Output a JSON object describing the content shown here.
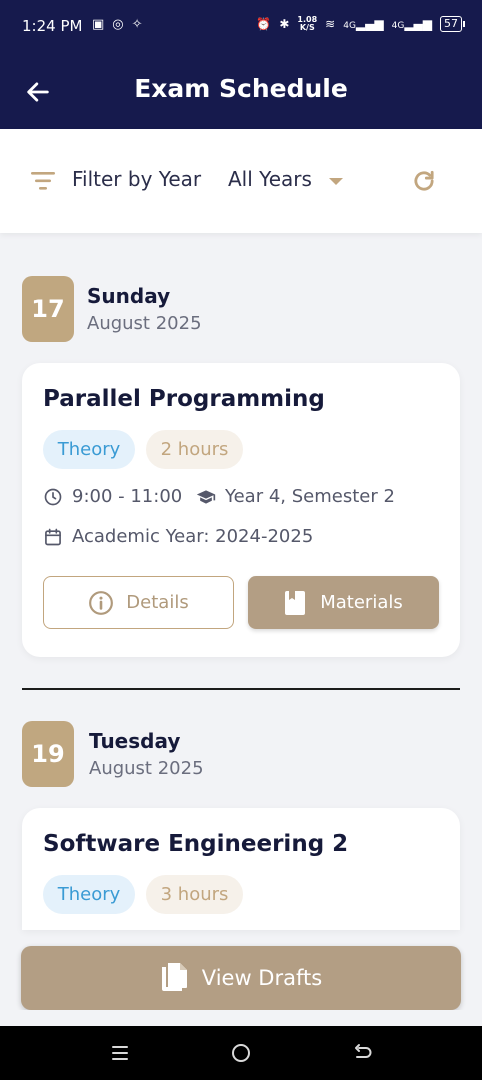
{
  "status_bar": {
    "time": "1:24 PM",
    "net_speed_value": "1.08",
    "net_speed_unit": "K/S",
    "signal_1": "4G",
    "signal_2": "4G",
    "battery": "57"
  },
  "app_bar": {
    "title": "Exam Schedule",
    "back_icon": "arrow-left-icon"
  },
  "filter": {
    "label": "Filter by Year",
    "value": "All Years",
    "refresh_icon": "refresh-icon"
  },
  "days": [
    {
      "date": "17",
      "day_name": "Sunday",
      "month_year": "August 2025",
      "exam": {
        "title": "Parallel Programming",
        "type": "Theory",
        "duration": "2 hours",
        "time": "9:00 - 11:00",
        "year_semester": "Year 4, Semester 2",
        "academic_year": "Academic Year: 2024-2025",
        "details_label": "Details",
        "materials_label": "Materials"
      }
    },
    {
      "date": "19",
      "day_name": "Tuesday",
      "month_year": "August 2025",
      "exam": {
        "title": "Software Engineering 2",
        "type": "Theory",
        "duration": "3 hours"
      }
    }
  ],
  "view_drafts_label": "View Drafts",
  "colors": {
    "header_bg": "#161a4d",
    "accent": "#c0a780",
    "button": "#b39e84",
    "theory_chip": "#3a9bd4"
  }
}
